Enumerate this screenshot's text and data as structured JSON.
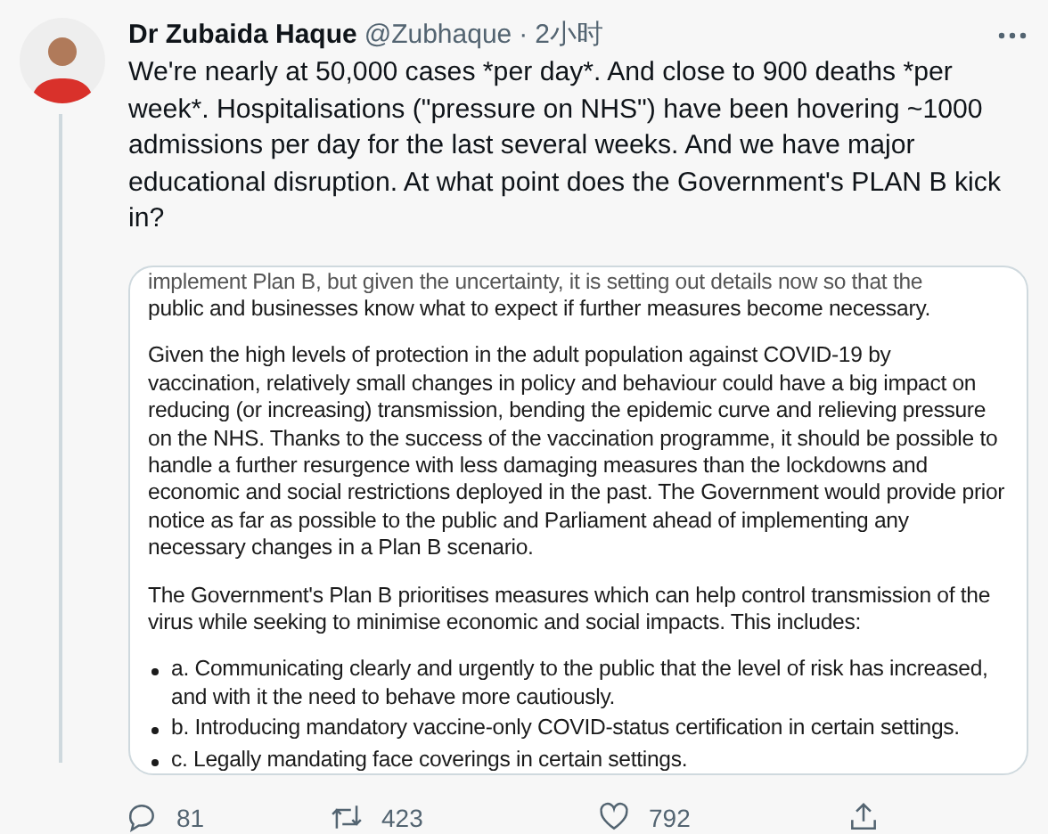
{
  "tweet": {
    "author_name": "Dr Zubaida Haque",
    "handle": "@Zubhaque",
    "separator": "·",
    "time": "2小时",
    "text": "We're nearly at 50,000 cases *per day*. And close to 900 deaths *per week*. Hospitalisations (\"pressure on NHS\") have been hovering ~1000 admissions per day for the last several weeks. And we have major educational disruption. At what point does the Government's PLAN B kick in?"
  },
  "document": {
    "cut_line": "implement Plan B, but given the uncertainty, it is setting out details now so that the",
    "paragraphs": [
      "public and businesses know what to expect if further measures become necessary.",
      "Given the high levels of protection in the adult population against COVID-19 by vaccination, relatively small changes in policy and behaviour could have a big impact on reducing (or increasing) transmission, bending the epidemic curve and relieving pressure on the NHS. Thanks to the success of the vaccination programme, it should be possible to handle a further resurgence with less damaging measures than the lockdowns and economic and social restrictions deployed in the past. The Government would provide prior notice as far as possible to the public and Parliament ahead of implementing any necessary changes in a Plan B scenario.",
      "The Government's Plan B prioritises measures which can help control transmission of the virus while seeking to minimise economic and social impacts. This includes:"
    ],
    "bullets": [
      "a. Communicating clearly and urgently to the public that the level of risk has increased, and with it the need to behave more cautiously.",
      "b. Introducing mandatory vaccine-only COVID-status certification in certain settings.",
      "c. Legally mandating face coverings in certain settings."
    ]
  },
  "actions": [
    {
      "kind": "reply",
      "count": "81"
    },
    {
      "kind": "retweet",
      "count": "423"
    },
    {
      "kind": "like",
      "count": "792"
    },
    {
      "kind": "share"
    }
  ]
}
